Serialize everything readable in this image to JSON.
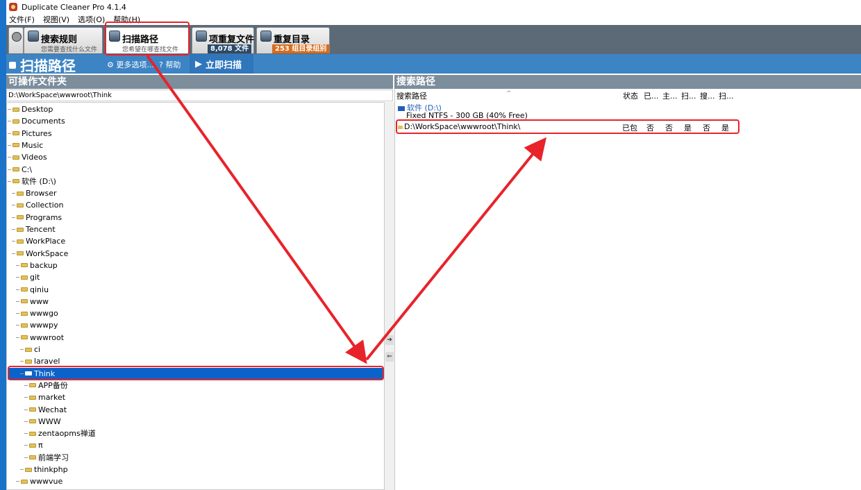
{
  "window": {
    "title": "Duplicate Cleaner Pro 4.1.4"
  },
  "menu": [
    "文件(F)",
    "视图(V)",
    "选项(O)",
    "帮助(H)"
  ],
  "tabs": [
    {
      "label": "搜索规则",
      "sub": "您需要查找什么文件"
    },
    {
      "label": "扫描路径",
      "sub": "您希望在哪查找文件"
    },
    {
      "label": "项重复文件",
      "badge": "8,078 文件",
      "badge_color": "#2a4a6a"
    },
    {
      "label": "重复目录",
      "badge": "253 组目录组别",
      "badge_color": "#d86c1c"
    }
  ],
  "toolbar": {
    "title": "扫描路径",
    "more_options": "更多选项...",
    "help": "帮助",
    "scan_now": "立即扫描"
  },
  "left_pane": {
    "title": "可操作文件夹",
    "current_path": "D:\\WorkSpace\\wwwroot\\Think",
    "tree": [
      {
        "label": "Desktop",
        "depth": 0
      },
      {
        "label": "Documents",
        "depth": 0
      },
      {
        "label": "Pictures",
        "depth": 0
      },
      {
        "label": "Music",
        "depth": 0
      },
      {
        "label": "Videos",
        "depth": 0
      },
      {
        "label": "C:\\",
        "depth": 0
      },
      {
        "label": "软件 (D:\\)",
        "depth": 0
      },
      {
        "label": "Browser",
        "depth": 1
      },
      {
        "label": "Collection",
        "depth": 1
      },
      {
        "label": "Programs",
        "depth": 1
      },
      {
        "label": "Tencent",
        "depth": 1
      },
      {
        "label": "WorkPlace",
        "depth": 1
      },
      {
        "label": "WorkSpace",
        "depth": 1
      },
      {
        "label": "backup",
        "depth": 2
      },
      {
        "label": "git",
        "depth": 2
      },
      {
        "label": "qiniu",
        "depth": 2
      },
      {
        "label": "www",
        "depth": 2
      },
      {
        "label": "wwwgo",
        "depth": 2
      },
      {
        "label": "wwwpy",
        "depth": 2
      },
      {
        "label": "wwwroot",
        "depth": 2
      },
      {
        "label": "ci",
        "depth": 3
      },
      {
        "label": "laravel",
        "depth": 3
      },
      {
        "label": "Think",
        "depth": 3,
        "selected": true
      },
      {
        "label": "APP备份",
        "depth": 4
      },
      {
        "label": "market",
        "depth": 4
      },
      {
        "label": "Wechat",
        "depth": 4
      },
      {
        "label": "WWW",
        "depth": 4
      },
      {
        "label": "zentaopms禅道",
        "depth": 4
      },
      {
        "label": "π",
        "depth": 4
      },
      {
        "label": "前端学习",
        "depth": 4
      },
      {
        "label": "thinkphp",
        "depth": 3
      },
      {
        "label": "wwwvue",
        "depth": 2
      }
    ]
  },
  "right_pane": {
    "title": "搜索路径",
    "columns": {
      "path": "搜索路径",
      "sort_glyph": "^",
      "status": "状态",
      "c1": "已...",
      "c2": "主...",
      "c3": "扫...",
      "c4": "搜...",
      "c5": "扫..."
    },
    "drive": "软件 (D:\\)",
    "drive_info": "Fixed NTFS - 300 GB (40% Free)",
    "row": {
      "path": "D:\\WorkSpace\\wwwroot\\Think\\",
      "status": "已包",
      "c1": "否",
      "c2": "否",
      "c3": "是",
      "c4": "否",
      "c5": "是"
    }
  },
  "accent": {
    "red": "#e8232a",
    "toolbar_blue": "#3d84c4",
    "select_blue": "#0b63c9"
  }
}
